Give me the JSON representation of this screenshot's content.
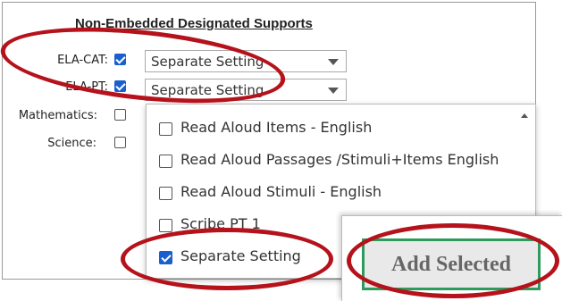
{
  "section": {
    "title": "Non-Embedded Designated Supports"
  },
  "rows": [
    {
      "label": "ELA-CAT:",
      "checked": true,
      "select_value": "Separate Setting"
    },
    {
      "label": "ELA-PT:",
      "checked": true,
      "select_value": "Separate Setting"
    },
    {
      "label": "Mathematics:",
      "checked": false
    },
    {
      "label": "Science:",
      "checked": false
    }
  ],
  "dropdown": {
    "options": [
      {
        "label": "Read Aloud Items - English",
        "checked": false
      },
      {
        "label": "Read Aloud Passages /Stimuli+Items English",
        "checked": false
      },
      {
        "label": "Read Aloud Stimuli - English",
        "checked": false
      },
      {
        "label": "Scribe PT 1",
        "checked": false
      },
      {
        "label": "Separate Setting",
        "checked": true
      }
    ]
  },
  "actions": {
    "add_selected": "Add Selected"
  },
  "colors": {
    "highlight": "#b5121b",
    "checkbox": "#1a5fd0",
    "button_border": "#2e9a5c"
  },
  "icons": [
    "chevron-down-icon",
    "scroll-up-icon"
  ]
}
